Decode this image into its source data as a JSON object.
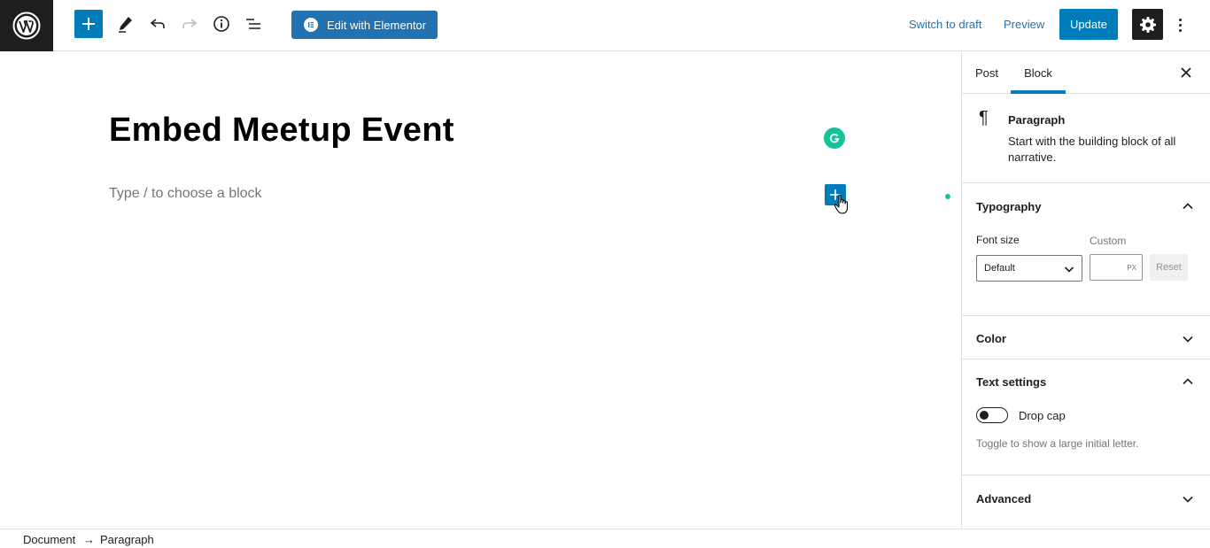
{
  "toolbar": {
    "elementor_label": "Edit with Elementor",
    "switch_to_draft": "Switch to draft",
    "preview": "Preview",
    "update": "Update"
  },
  "editor": {
    "title": "Embed Meetup Event",
    "placeholder": "Type / to choose a block"
  },
  "sidebar": {
    "tabs": [
      {
        "label": "Post",
        "active": false
      },
      {
        "label": "Block",
        "active": true
      }
    ],
    "block_card": {
      "title": "Paragraph",
      "description": "Start with the building block of all narrative."
    },
    "typography": {
      "heading": "Typography",
      "font_size_label": "Font size",
      "custom_label": "Custom",
      "select_value": "Default",
      "unit": "PX",
      "reset_label": "Reset"
    },
    "color": {
      "heading": "Color"
    },
    "text_settings": {
      "heading": "Text settings",
      "drop_cap_label": "Drop cap",
      "drop_cap_on": false,
      "help": "Toggle to show a large initial letter."
    },
    "advanced": {
      "heading": "Advanced"
    }
  },
  "breadcrumb": {
    "items": [
      "Document",
      "Paragraph"
    ],
    "separator": "→"
  },
  "colors": {
    "accent": "#007cba",
    "link": "#2271b1",
    "dark": "#1e1e1e",
    "grammarly": "#15c39a"
  }
}
